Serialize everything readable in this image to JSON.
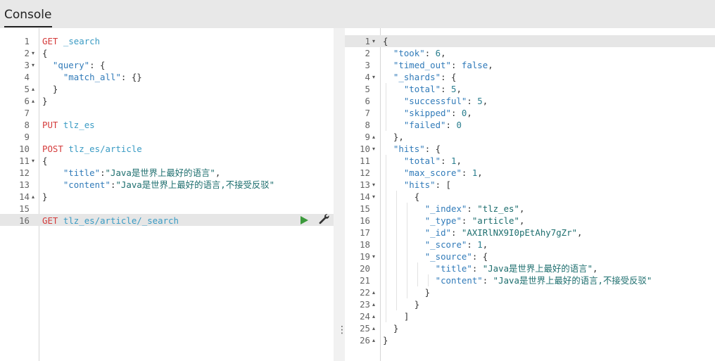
{
  "header": {
    "tab_label": "Console"
  },
  "request_lines": [
    {
      "n": "1",
      "fold": "",
      "tokens": [
        {
          "c": "m",
          "t": "GET"
        },
        {
          "c": "p",
          "t": " "
        },
        {
          "c": "u",
          "t": "_search"
        }
      ]
    },
    {
      "n": "2",
      "fold": "▾",
      "tokens": [
        {
          "c": "p",
          "t": "{"
        }
      ]
    },
    {
      "n": "3",
      "fold": "▾",
      "tokens": [
        {
          "c": "p",
          "t": "  "
        },
        {
          "c": "k",
          "t": "\"query\""
        },
        {
          "c": "p",
          "t": ": {"
        }
      ]
    },
    {
      "n": "4",
      "fold": "",
      "tokens": [
        {
          "c": "p",
          "t": "    "
        },
        {
          "c": "k",
          "t": "\"match_all\""
        },
        {
          "c": "p",
          "t": ": {}"
        }
      ]
    },
    {
      "n": "5",
      "fold": "▴",
      "tokens": [
        {
          "c": "p",
          "t": "  }"
        }
      ]
    },
    {
      "n": "6",
      "fold": "▴",
      "tokens": [
        {
          "c": "p",
          "t": "}"
        }
      ]
    },
    {
      "n": "7",
      "fold": "",
      "tokens": []
    },
    {
      "n": "8",
      "fold": "",
      "tokens": [
        {
          "c": "m",
          "t": "PUT"
        },
        {
          "c": "p",
          "t": " "
        },
        {
          "c": "u",
          "t": "tlz_es"
        }
      ]
    },
    {
      "n": "9",
      "fold": "",
      "tokens": []
    },
    {
      "n": "10",
      "fold": "",
      "tokens": [
        {
          "c": "m",
          "t": "POST"
        },
        {
          "c": "p",
          "t": " "
        },
        {
          "c": "u",
          "t": "tlz_es/article"
        }
      ]
    },
    {
      "n": "11",
      "fold": "▾",
      "tokens": [
        {
          "c": "p",
          "t": "{"
        }
      ]
    },
    {
      "n": "12",
      "fold": "",
      "tokens": [
        {
          "c": "p",
          "t": "    "
        },
        {
          "c": "k",
          "t": "\"title\""
        },
        {
          "c": "p",
          "t": ":"
        },
        {
          "c": "s",
          "t": "\"Java是世界上最好的语言\""
        },
        {
          "c": "p",
          "t": ","
        }
      ]
    },
    {
      "n": "13",
      "fold": "",
      "tokens": [
        {
          "c": "p",
          "t": "    "
        },
        {
          "c": "k",
          "t": "\"content\""
        },
        {
          "c": "p",
          "t": ":"
        },
        {
          "c": "s",
          "t": "\"Java是世界上最好的语言,不接受反驳\""
        }
      ]
    },
    {
      "n": "14",
      "fold": "▴",
      "tokens": [
        {
          "c": "p",
          "t": "}"
        }
      ]
    },
    {
      "n": "15",
      "fold": "",
      "tokens": []
    },
    {
      "n": "16",
      "fold": "",
      "tokens": [
        {
          "c": "m",
          "t": "GET"
        },
        {
          "c": "p",
          "t": " "
        },
        {
          "c": "u",
          "t": "tlz_es/article/_search"
        }
      ]
    }
  ],
  "response_lines": [
    {
      "n": "1",
      "fold": "▾",
      "tokens": [
        {
          "c": "p",
          "t": "{"
        }
      ]
    },
    {
      "n": "2",
      "fold": "",
      "tokens": [
        {
          "c": "p",
          "t": "  "
        },
        {
          "c": "k",
          "t": "\"took\""
        },
        {
          "c": "p",
          "t": ": "
        },
        {
          "c": "n",
          "t": "6"
        },
        {
          "c": "p",
          "t": ","
        }
      ]
    },
    {
      "n": "3",
      "fold": "",
      "tokens": [
        {
          "c": "p",
          "t": "  "
        },
        {
          "c": "k",
          "t": "\"timed_out\""
        },
        {
          "c": "p",
          "t": ": "
        },
        {
          "c": "b",
          "t": "false"
        },
        {
          "c": "p",
          "t": ","
        }
      ]
    },
    {
      "n": "4",
      "fold": "▾",
      "tokens": [
        {
          "c": "p",
          "t": "  "
        },
        {
          "c": "k",
          "t": "\"_shards\""
        },
        {
          "c": "p",
          "t": ": {"
        }
      ]
    },
    {
      "n": "5",
      "fold": "",
      "tokens": [
        {
          "c": "p",
          "t": "    "
        },
        {
          "c": "k",
          "t": "\"total\""
        },
        {
          "c": "p",
          "t": ": "
        },
        {
          "c": "n",
          "t": "5"
        },
        {
          "c": "p",
          "t": ","
        }
      ]
    },
    {
      "n": "6",
      "fold": "",
      "tokens": [
        {
          "c": "p",
          "t": "    "
        },
        {
          "c": "k",
          "t": "\"successful\""
        },
        {
          "c": "p",
          "t": ": "
        },
        {
          "c": "n",
          "t": "5"
        },
        {
          "c": "p",
          "t": ","
        }
      ]
    },
    {
      "n": "7",
      "fold": "",
      "tokens": [
        {
          "c": "p",
          "t": "    "
        },
        {
          "c": "k",
          "t": "\"skipped\""
        },
        {
          "c": "p",
          "t": ": "
        },
        {
          "c": "n",
          "t": "0"
        },
        {
          "c": "p",
          "t": ","
        }
      ]
    },
    {
      "n": "8",
      "fold": "",
      "tokens": [
        {
          "c": "p",
          "t": "    "
        },
        {
          "c": "k",
          "t": "\"failed\""
        },
        {
          "c": "p",
          "t": ": "
        },
        {
          "c": "n",
          "t": "0"
        }
      ]
    },
    {
      "n": "9",
      "fold": "▴",
      "tokens": [
        {
          "c": "p",
          "t": "  },"
        }
      ]
    },
    {
      "n": "10",
      "fold": "▾",
      "tokens": [
        {
          "c": "p",
          "t": "  "
        },
        {
          "c": "k",
          "t": "\"hits\""
        },
        {
          "c": "p",
          "t": ": {"
        }
      ]
    },
    {
      "n": "11",
      "fold": "",
      "tokens": [
        {
          "c": "p",
          "t": "    "
        },
        {
          "c": "k",
          "t": "\"total\""
        },
        {
          "c": "p",
          "t": ": "
        },
        {
          "c": "n",
          "t": "1"
        },
        {
          "c": "p",
          "t": ","
        }
      ]
    },
    {
      "n": "12",
      "fold": "",
      "tokens": [
        {
          "c": "p",
          "t": "    "
        },
        {
          "c": "k",
          "t": "\"max_score\""
        },
        {
          "c": "p",
          "t": ": "
        },
        {
          "c": "n",
          "t": "1"
        },
        {
          "c": "p",
          "t": ","
        }
      ]
    },
    {
      "n": "13",
      "fold": "▾",
      "tokens": [
        {
          "c": "p",
          "t": "    "
        },
        {
          "c": "k",
          "t": "\"hits\""
        },
        {
          "c": "p",
          "t": ": ["
        }
      ]
    },
    {
      "n": "14",
      "fold": "▾",
      "tokens": [
        {
          "c": "p",
          "t": "      {"
        }
      ]
    },
    {
      "n": "15",
      "fold": "",
      "tokens": [
        {
          "c": "p",
          "t": "        "
        },
        {
          "c": "k",
          "t": "\"_index\""
        },
        {
          "c": "p",
          "t": ": "
        },
        {
          "c": "s",
          "t": "\"tlz_es\""
        },
        {
          "c": "p",
          "t": ","
        }
      ]
    },
    {
      "n": "16",
      "fold": "",
      "tokens": [
        {
          "c": "p",
          "t": "        "
        },
        {
          "c": "k",
          "t": "\"_type\""
        },
        {
          "c": "p",
          "t": ": "
        },
        {
          "c": "s",
          "t": "\"article\""
        },
        {
          "c": "p",
          "t": ","
        }
      ]
    },
    {
      "n": "17",
      "fold": "",
      "tokens": [
        {
          "c": "p",
          "t": "        "
        },
        {
          "c": "k",
          "t": "\"_id\""
        },
        {
          "c": "p",
          "t": ": "
        },
        {
          "c": "s",
          "t": "\"AXIRlNX9I0pEtAhy7gZr\""
        },
        {
          "c": "p",
          "t": ","
        }
      ]
    },
    {
      "n": "18",
      "fold": "",
      "tokens": [
        {
          "c": "p",
          "t": "        "
        },
        {
          "c": "k",
          "t": "\"_score\""
        },
        {
          "c": "p",
          "t": ": "
        },
        {
          "c": "n",
          "t": "1"
        },
        {
          "c": "p",
          "t": ","
        }
      ]
    },
    {
      "n": "19",
      "fold": "▾",
      "tokens": [
        {
          "c": "p",
          "t": "        "
        },
        {
          "c": "k",
          "t": "\"_source\""
        },
        {
          "c": "p",
          "t": ": {"
        }
      ]
    },
    {
      "n": "20",
      "fold": "",
      "tokens": [
        {
          "c": "p",
          "t": "          "
        },
        {
          "c": "k",
          "t": "\"title\""
        },
        {
          "c": "p",
          "t": ": "
        },
        {
          "c": "s",
          "t": "\"Java是世界上最好的语言\""
        },
        {
          "c": "p",
          "t": ","
        }
      ]
    },
    {
      "n": "21",
      "fold": "",
      "tokens": [
        {
          "c": "p",
          "t": "          "
        },
        {
          "c": "k",
          "t": "\"content\""
        },
        {
          "c": "p",
          "t": ": "
        },
        {
          "c": "s",
          "t": "\"Java是世界上最好的语言,不接受反驳\""
        }
      ]
    },
    {
      "n": "22",
      "fold": "▴",
      "tokens": [
        {
          "c": "p",
          "t": "        }"
        }
      ]
    },
    {
      "n": "23",
      "fold": "▴",
      "tokens": [
        {
          "c": "p",
          "t": "      }"
        }
      ]
    },
    {
      "n": "24",
      "fold": "▴",
      "tokens": [
        {
          "c": "p",
          "t": "    ]"
        }
      ]
    },
    {
      "n": "25",
      "fold": "▴",
      "tokens": [
        {
          "c": "p",
          "t": "  }"
        }
      ]
    },
    {
      "n": "26",
      "fold": "▴",
      "tokens": [
        {
          "c": "p",
          "t": "}"
        }
      ]
    }
  ],
  "icons": {
    "run": "play-icon",
    "settings": "wrench-icon",
    "resize": "drag-handle-icon"
  },
  "colors": {
    "method": "#d43a3a",
    "url": "#3a9bc4",
    "key": "#317bb9",
    "string": "#1d6e6e",
    "run": "#3c9a3c"
  }
}
